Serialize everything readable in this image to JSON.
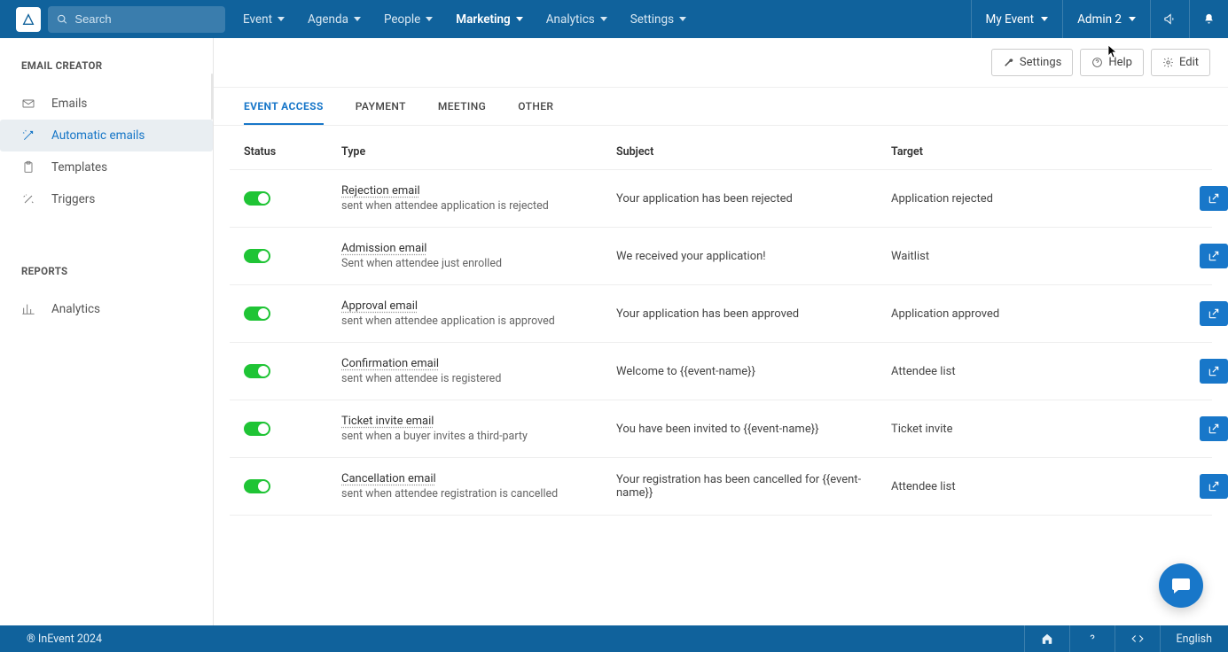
{
  "topnav": {
    "search_placeholder": "Search",
    "items": [
      {
        "label": "Event",
        "active": false
      },
      {
        "label": "Agenda",
        "active": false
      },
      {
        "label": "People",
        "active": false
      },
      {
        "label": "Marketing",
        "active": true
      },
      {
        "label": "Analytics",
        "active": false
      },
      {
        "label": "Settings",
        "active": false
      }
    ],
    "event_switcher": "My Event",
    "user_switcher": "Admin 2"
  },
  "sidebar": {
    "section1_title": "EMAIL CREATOR",
    "items": [
      {
        "label": "Emails",
        "icon": "envelope-icon",
        "active": false
      },
      {
        "label": "Automatic emails",
        "icon": "magic-wand-icon",
        "active": true
      },
      {
        "label": "Templates",
        "icon": "clipboard-icon",
        "active": false
      },
      {
        "label": "Triggers",
        "icon": "wand-sparkle-icon",
        "active": false
      }
    ],
    "section2_title": "REPORTS",
    "items2": [
      {
        "label": "Analytics",
        "icon": "bar-chart-icon",
        "active": false
      }
    ]
  },
  "content_header": {
    "settings_label": "Settings",
    "help_label": "Help",
    "edit_label": "Edit"
  },
  "tabs": [
    {
      "label": "EVENT ACCESS",
      "active": true
    },
    {
      "label": "PAYMENT",
      "active": false
    },
    {
      "label": "MEETING",
      "active": false
    },
    {
      "label": "OTHER",
      "active": false
    }
  ],
  "table": {
    "columns": [
      "Status",
      "Type",
      "Subject",
      "Target"
    ],
    "rows": [
      {
        "status": true,
        "type_name": "Rejection email",
        "type_desc": "sent when attendee application is rejected",
        "subject": "Your application has been rejected",
        "target": "Application rejected"
      },
      {
        "status": true,
        "type_name": "Admission email",
        "type_desc": "Sent when attendee just enrolled",
        "subject": "We received your application!",
        "target": "Waitlist"
      },
      {
        "status": true,
        "type_name": "Approval email",
        "type_desc": "sent when attendee application is approved",
        "subject": "Your application has been approved",
        "target": "Application approved"
      },
      {
        "status": true,
        "type_name": "Confirmation email",
        "type_desc": "sent when attendee is registered",
        "subject": "Welcome to {{event-name}}",
        "target": "Attendee list"
      },
      {
        "status": true,
        "type_name": "Ticket invite email",
        "type_desc": "sent when a buyer invites a third-party",
        "subject": "You have been invited to {{event-name}}",
        "target": "Ticket invite"
      },
      {
        "status": true,
        "type_name": "Cancellation email",
        "type_desc": "sent when attendee registration is cancelled",
        "subject": "Your registration has been cancelled for {{event-name}}",
        "target": "Attendee list"
      }
    ]
  },
  "footer": {
    "copyright": "® InEvent 2024",
    "language": "English"
  }
}
